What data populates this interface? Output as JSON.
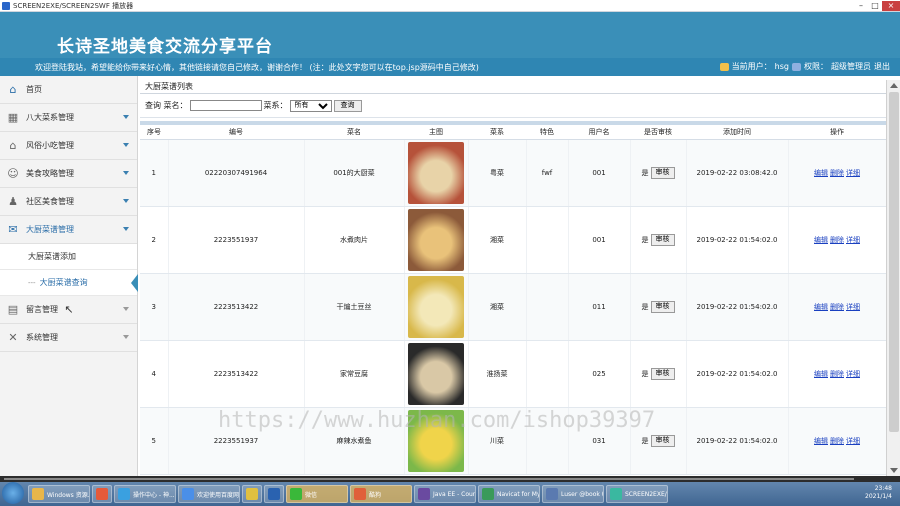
{
  "window": {
    "title": "SCREEN2EXE/SCREEN2SWF 播放器"
  },
  "header": {
    "brand": "长诗圣地美食交流分享平台",
    "welcome": "欢迎登陆我站，希望能给你带来好心情，其他链接请您自己修改，谢谢合作！ (注：此处文字您可以在top.jsp源码中自己修改)",
    "current_user_label": "当前用户：",
    "current_user": "hsg",
    "role_label": "权限：",
    "role": "超级管理员",
    "logout": "退出"
  },
  "sidebar": {
    "items": [
      {
        "label": "首页",
        "icon": "home-icon"
      },
      {
        "label": "八大菜系管理",
        "icon": "grid-icon"
      },
      {
        "label": "风俗小吃管理",
        "icon": "house-icon"
      },
      {
        "label": "美食攻略管理",
        "icon": "users-icon"
      },
      {
        "label": "社区美食管理",
        "icon": "user-icon"
      },
      {
        "label": "大厨菜谱管理",
        "icon": "chat-icon"
      },
      {
        "label": "留言管理",
        "icon": "message-icon"
      },
      {
        "label": "系统管理",
        "icon": "tools-icon"
      }
    ],
    "subitems": [
      {
        "label": "大厨菜谱添加"
      },
      {
        "label": "大厨菜谱查询"
      }
    ]
  },
  "panel": {
    "title": "大厨菜谱列表"
  },
  "search": {
    "label_name": "查询 菜名：",
    "value": "",
    "label_type": "菜系：",
    "type_selected": "所有",
    "button": "查询"
  },
  "table": {
    "headers": [
      "序号",
      "编号",
      "菜名",
      "主图",
      "菜系",
      "特色",
      "用户名",
      "是否审核",
      "添加时间",
      "操作"
    ],
    "rows": [
      {
        "no": "1",
        "code": "02220307491964",
        "name": "001的大厨菜",
        "type": "粤菜",
        "feature": "fwf",
        "user": "001",
        "audited": "是",
        "audit_btn": "审核",
        "time": "2019-02-22 03:08:42.0",
        "img_a": "#b6523a",
        "img_b": "#e8d3a8"
      },
      {
        "no": "2",
        "code": "2223551937",
        "name": "水煮肉片",
        "type": "湘菜",
        "feature": "",
        "user": "001",
        "audited": "是",
        "audit_btn": "审核",
        "time": "2019-02-22 01:54:02.0",
        "img_a": "#8c5a3a",
        "img_b": "#e9c27a"
      },
      {
        "no": "3",
        "code": "2223513422",
        "name": "干煸土豆丝",
        "type": "湘菜",
        "feature": "",
        "user": "011",
        "audited": "是",
        "audit_btn": "审核",
        "time": "2019-02-22 01:54:02.0",
        "img_a": "#d8b84a",
        "img_b": "#f3e8b8"
      },
      {
        "no": "4",
        "code": "2223513422",
        "name": "家常豆腐",
        "type": "淮扬菜",
        "feature": "",
        "user": "025",
        "audited": "是",
        "audit_btn": "审核",
        "time": "2019-02-22 01:54:02.0",
        "img_a": "#2a2a2a",
        "img_b": "#d9c8a6"
      },
      {
        "no": "5",
        "code": "2223551937",
        "name": "麻辣水煮鱼",
        "type": "川菜",
        "feature": "",
        "user": "031",
        "audited": "是",
        "audit_btn": "审核",
        "time": "2019-02-22 01:54:02.0",
        "img_a": "#7cb84a",
        "img_b": "#f0d44a"
      }
    ],
    "actions": [
      "编辑",
      "删除",
      "详细"
    ]
  },
  "watermark": "https://www.huzhan.com/ishop39397",
  "taskbar": {
    "tasks": [
      {
        "label": "Windows 资源...",
        "color": "#e8b64a"
      },
      {
        "label": "",
        "color": "#e55a3a"
      },
      {
        "label": "操作中心 - 神...",
        "color": "#3aa0e0"
      },
      {
        "label": "欢迎使用百度网盘",
        "color": "#4a8fe8"
      },
      {
        "label": "",
        "color": "#e0c040"
      },
      {
        "label": "",
        "color": "#2a62b0"
      },
      {
        "label": "微信",
        "color": "#3ab83a"
      },
      {
        "label": "酷狗",
        "color": "#e0603a"
      },
      {
        "label": "Java EE - Cours...",
        "color": "#6a4aa0"
      },
      {
        "label": "Navicat for MyS...",
        "color": "#3a9a5a"
      },
      {
        "label": "Luser @book (l...",
        "color": "#5a7ab0"
      },
      {
        "label": "SCREEN2EXE/E...",
        "color": "#3ab8a0"
      }
    ],
    "clock_time": "23:48",
    "clock_date": "2021/1/4"
  }
}
